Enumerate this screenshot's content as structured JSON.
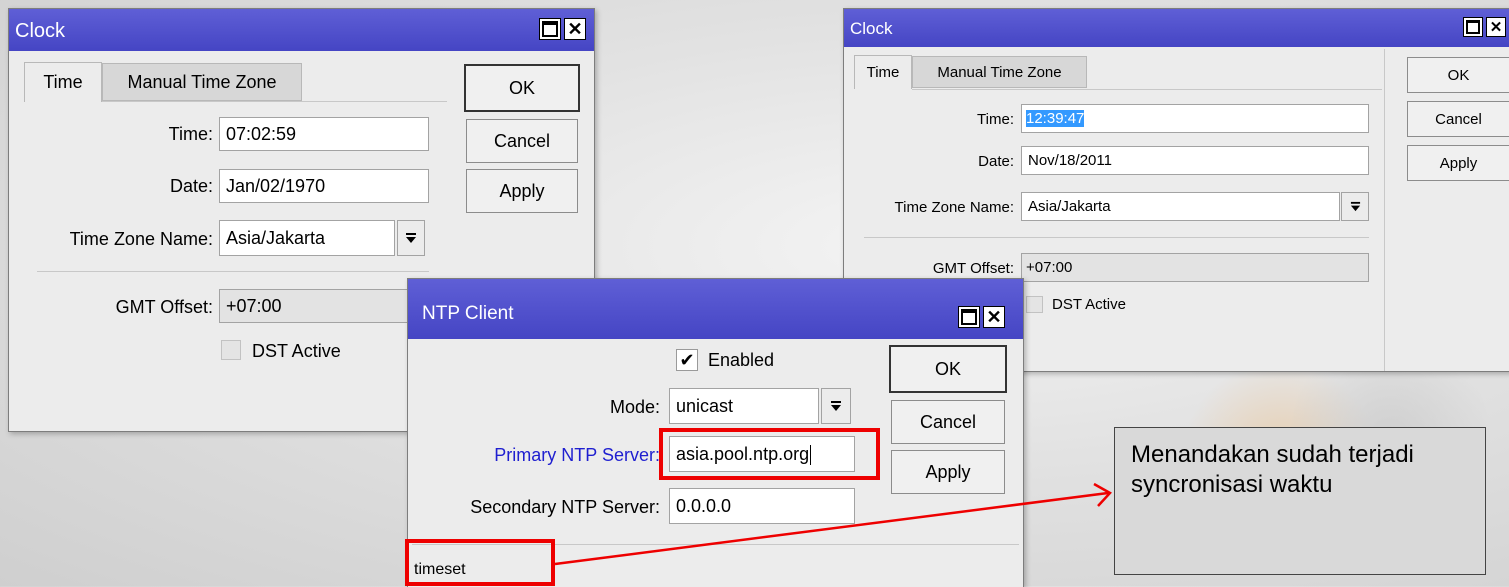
{
  "colors": {
    "titlebar": "#4a4ac8",
    "link_blue": "#1f1fd0",
    "highlight": "#e00000",
    "selection": "#3399ff"
  },
  "clock_left": {
    "title": "Clock",
    "titlebar_icons": [
      "maximize-icon",
      "close-icon"
    ],
    "tabs": [
      {
        "label": "Time"
      },
      {
        "label": "Manual Time Zone"
      }
    ],
    "fields": {
      "time": {
        "label": "Time:",
        "value": "07:02:59"
      },
      "date": {
        "label": "Date:",
        "value": "Jan/02/1970"
      },
      "tz": {
        "label": "Time Zone Name:",
        "value": "Asia/Jakarta"
      },
      "gmt": {
        "label": "GMT Offset:",
        "value": "+07:00"
      },
      "dst": {
        "label": "DST Active"
      }
    },
    "buttons": {
      "ok": "OK",
      "cancel": "Cancel",
      "apply": "Apply"
    }
  },
  "clock_right": {
    "title": "Clock",
    "titlebar_icons": [
      "maximize-icon",
      "close-icon"
    ],
    "tabs": [
      {
        "label": "Time"
      },
      {
        "label": "Manual Time Zone"
      }
    ],
    "fields": {
      "time": {
        "label": "Time:",
        "value": "12:39:47"
      },
      "date": {
        "label": "Date:",
        "value": "Nov/18/2011"
      },
      "tz": {
        "label": "Time Zone Name:",
        "value": "Asia/Jakarta"
      },
      "gmt": {
        "label": "GMT Offset:",
        "value": "+07:00"
      },
      "dst": {
        "label": "DST Active"
      }
    },
    "buttons": {
      "ok": "OK",
      "cancel": "Cancel",
      "apply": "Apply"
    }
  },
  "ntp": {
    "title": "NTP Client",
    "titlebar_icons": [
      "maximize-icon",
      "close-icon"
    ],
    "enabled": {
      "label": "Enabled",
      "checked": true
    },
    "mode": {
      "label": "Mode:",
      "value": "unicast"
    },
    "primary": {
      "label": "Primary NTP Server:",
      "value": "asia.pool.ntp.org"
    },
    "secondary": {
      "label": "Secondary NTP Server:",
      "value": "0.0.0.0"
    },
    "status": "timeset",
    "buttons": {
      "ok": "OK",
      "cancel": "Cancel",
      "apply": "Apply"
    }
  },
  "callout": {
    "text": "Menandakan sudah terjadi syncronisasi waktu"
  }
}
